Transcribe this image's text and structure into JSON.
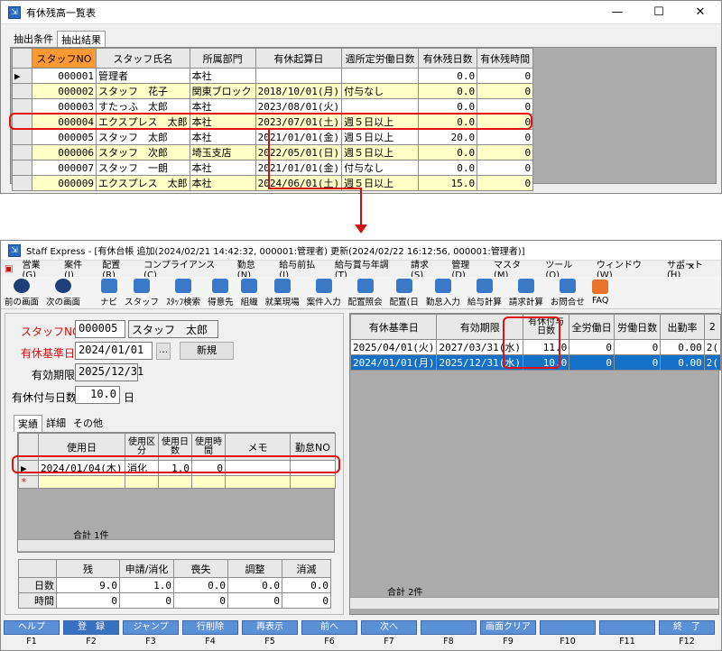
{
  "win1": {
    "title": "有休残高一覧表",
    "controls": [
      "—",
      "☐",
      "✕"
    ],
    "tabs": [
      "抽出条件",
      "抽出結果"
    ],
    "columns": [
      "スタッフNO",
      "スタッフ氏名",
      "所属部門",
      "有休起算日",
      "週所定労働日数",
      "有休残日数",
      "有休残時間"
    ],
    "rows": [
      [
        "000001",
        "管理者",
        "本社",
        "",
        "",
        "0.0",
        "0"
      ],
      [
        "000002",
        "スタッフ　花子",
        "関東ブロック",
        "2018/10/01(月)",
        "付与なし",
        "0.0",
        "0"
      ],
      [
        "000003",
        "すたっふ　太郎",
        "本社",
        "2023/08/01(火)",
        "",
        "0.0",
        "0"
      ],
      [
        "000004",
        "エクスプレス　太郎",
        "本社",
        "2023/07/01(土)",
        "週５日以上",
        "0.0",
        "0"
      ],
      [
        "000005",
        "スタッフ　太郎",
        "本社",
        "2021/01/01(金)",
        "週５日以上",
        "20.0",
        "0"
      ],
      [
        "000006",
        "スタッフ　次郎",
        "埼玉支店",
        "2022/05/01(日)",
        "週５日以上",
        "0.0",
        "0"
      ],
      [
        "000007",
        "スタッフ　一朗",
        "本社",
        "2021/01/01(金)",
        "付与なし",
        "0.0",
        "0"
      ],
      [
        "000009",
        "エクスプレス　太郎",
        "本社",
        "2024/06/01(土)",
        "週５日以上",
        "15.0",
        "0"
      ]
    ]
  },
  "win2": {
    "title": "Staff Express - [有休台帳 追加(2024/02/21 14:42:32, 000001:管理者) 更新(2024/02/22 16:12:56, 000001:管理者)]",
    "menu": [
      "営業(G)",
      "案件(J)",
      "配置(R)",
      "コンプライアンス(C)",
      "勤怠(N)",
      "給与前払(I)",
      "給与賞与年調(T)",
      "請求(S)",
      "管理(D)",
      "マスタ(M)",
      "ツール(O)",
      "ウィンドウ(W)",
      "サポート(H)"
    ],
    "nav": [
      "前の画面",
      "次の画面"
    ],
    "toolbar": [
      "ナビ",
      "スタッフ",
      "ｽﾀｯﾌ検索",
      "得意先",
      "組織",
      "就業現場",
      "案件入力",
      "配置照会",
      "配置(日",
      "勤怠入力",
      "給与計算",
      "請求計算",
      "お問合せ",
      "FAQ"
    ],
    "form": {
      "staff_no_label": "スタッフNO",
      "staff_no": "000005",
      "staff_name": "スタッフ　太郎",
      "base_date_label": "有休基準日",
      "base_date": "2024/01/01",
      "dots": "...",
      "new_button": "新規",
      "expiry_label": "有効期限",
      "expiry": "2025/12/31",
      "grant_label": "有休付与日数",
      "grant": "10.0",
      "grant_unit": "日"
    },
    "tabs": [
      "実績",
      "詳細",
      "その他"
    ],
    "usage_columns": [
      "使用日",
      "使用区分",
      "使用日数",
      "使用時間",
      "メモ",
      "勤怠NO"
    ],
    "usage_rows": [
      [
        "2024/01/04(木)",
        "消化",
        "1.0",
        "0",
        "",
        ""
      ]
    ],
    "usage_total": "合計 1件",
    "balance_columns": [
      "残",
      "申請/消化",
      "喪失",
      "調整",
      "消滅"
    ],
    "balance_rows": [
      {
        "label": "日数",
        "values": [
          "9.0",
          "1.0",
          "0.0",
          "0.0",
          "0.0"
        ]
      },
      {
        "label": "時間",
        "values": [
          "0",
          "0",
          "0",
          "0",
          "0"
        ]
      }
    ],
    "right_columns": [
      "有休基準日",
      "有効期限",
      "有休付与日数",
      "全労働日",
      "労働日数",
      "出勤率",
      "2"
    ],
    "right_rows": [
      [
        "2025/04/01(火)",
        "2027/03/31(水)",
        "11.0",
        "0",
        "0",
        "0.00",
        "2("
      ],
      [
        "2024/01/01(月)",
        "2025/12/31(水)",
        "10.0",
        "0",
        "0",
        "0.00",
        "2("
      ]
    ],
    "right_total": "合計 2件",
    "fkeys": [
      {
        "label": "ヘルプ",
        "key": "F1"
      },
      {
        "label": "登　録",
        "key": "F2"
      },
      {
        "label": "ジャンプ",
        "key": "F3"
      },
      {
        "label": "行削除",
        "key": "F4"
      },
      {
        "label": "再表示",
        "key": "F5"
      },
      {
        "label": "前へ",
        "key": "F6"
      },
      {
        "label": "次へ",
        "key": "F7"
      },
      {
        "label": "",
        "key": "F8"
      },
      {
        "label": "画面クリア",
        "key": "F9"
      },
      {
        "label": "",
        "key": "F10"
      },
      {
        "label": "",
        "key": "F11"
      },
      {
        "label": "終　了",
        "key": "F12"
      }
    ]
  },
  "colors": {
    "highlight": "#e21010",
    "accent": "#5b8fd6",
    "selected": "#1570c8",
    "header_orange": "#ff9933"
  }
}
